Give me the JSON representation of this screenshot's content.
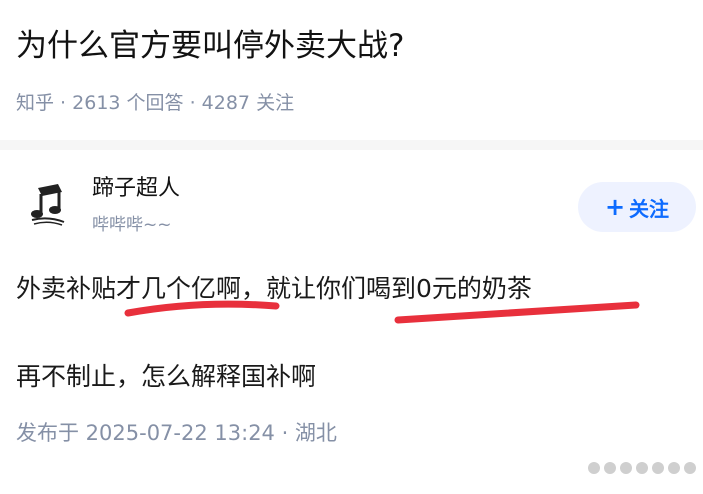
{
  "question": {
    "title": "为什么官方要叫停外卖大战?",
    "source": "知乎",
    "separator": " · ",
    "answers": "2613 个回答",
    "followers": "4287 关注"
  },
  "author": {
    "avatar_icon": "music-note-icon",
    "name": "蹄子超人",
    "bio": "哔哔哔~~"
  },
  "follow_button": {
    "icon": "+",
    "label": "关注"
  },
  "answer": {
    "line1": "外卖补贴才几个亿啊，就让你们喝到0元的奶茶",
    "line2": "再不制止，怎么解释国补啊",
    "published": "发布于 2025-07-22 13:24 · 湖北"
  },
  "colors": {
    "accent": "#0d6bff",
    "meta": "#8590a6",
    "annotation": "#e8303c"
  }
}
